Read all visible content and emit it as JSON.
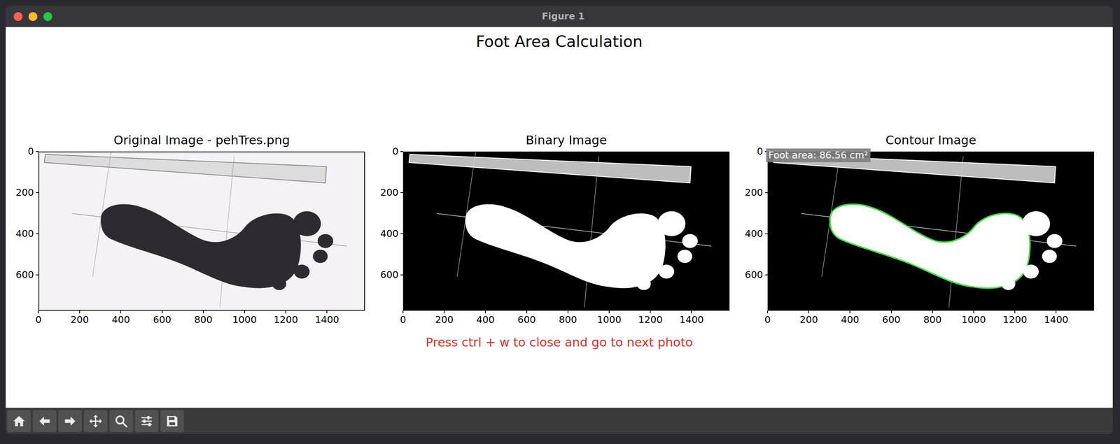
{
  "window": {
    "title": "Figure 1"
  },
  "figure": {
    "title": "Foot Area Calculation",
    "hint": "Press ctrl + w to close and go to next photo"
  },
  "subplots": [
    {
      "title": "Original Image - pehTres.png",
      "kind": "original",
      "x_ticks": [
        "0",
        "200",
        "400",
        "600",
        "800",
        "1000",
        "1200",
        "1400"
      ],
      "y_ticks": [
        "0",
        "200",
        "400",
        "600"
      ]
    },
    {
      "title": "Binary Image",
      "kind": "binary",
      "x_ticks": [
        "0",
        "200",
        "400",
        "600",
        "800",
        "1000",
        "1200",
        "1400"
      ],
      "y_ticks": [
        "0",
        "200",
        "400",
        "600"
      ]
    },
    {
      "title": "Contour Image",
      "kind": "contour",
      "annotation": "Foot area: 86.56 cm²",
      "x_ticks": [
        "0",
        "200",
        "400",
        "600",
        "800",
        "1000",
        "1200",
        "1400"
      ],
      "y_ticks": [
        "0",
        "200",
        "400",
        "600"
      ]
    }
  ]
}
